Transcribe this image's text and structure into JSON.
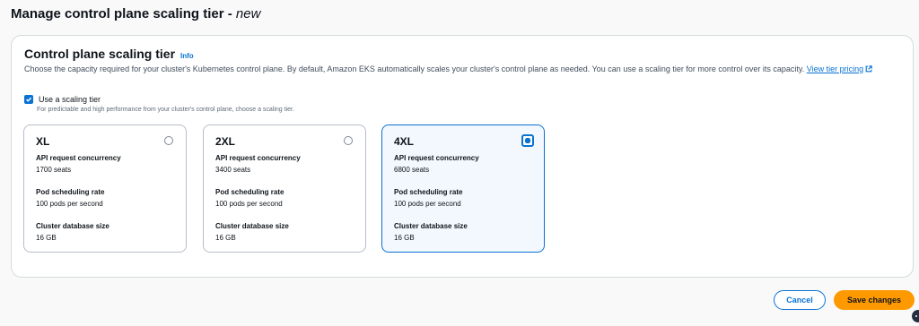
{
  "header": {
    "title": "Manage control plane scaling tier - ",
    "title_suffix": "new"
  },
  "section": {
    "title": "Control plane scaling tier",
    "info_label": "Info",
    "description": "Choose the capacity required for your cluster's Kubernetes control plane. By default, Amazon EKS automatically scales your cluster's control plane as needed. You can use a scaling tier for more control over its capacity.",
    "link_label": "View tier pricing"
  },
  "scaling_checkbox": {
    "label": "Use a scaling tier",
    "checked": true,
    "description": "For predictable and high performance from your cluster's control plane, choose a scaling tier."
  },
  "tiers": [
    {
      "name": "XL",
      "selected": false,
      "api_label": "API request concurrency",
      "api_value": "1700 seats",
      "pod_label": "Pod scheduling rate",
      "pod_value": "100 pods per second",
      "db_label": "Cluster database size",
      "db_value": "16 GB"
    },
    {
      "name": "2XL",
      "selected": false,
      "api_label": "API request concurrency",
      "api_value": "3400 seats",
      "pod_label": "Pod scheduling rate",
      "pod_value": "100 pods per second",
      "db_label": "Cluster database size",
      "db_value": "16 GB"
    },
    {
      "name": "4XL",
      "selected": true,
      "api_label": "API request concurrency",
      "api_value": "6800 seats",
      "pod_label": "Pod scheduling rate",
      "pod_value": "100 pods per second",
      "db_label": "Cluster database size",
      "db_value": "16 GB"
    }
  ],
  "actions": {
    "cancel_label": "Cancel",
    "save_label": "Save changes"
  },
  "icons": {
    "external": "external-link-icon",
    "check": "check-icon",
    "widget": "help-widget-icon"
  },
  "colors": {
    "accent": "#0972d3",
    "primary_button": "#ff9900",
    "selected_tile_bg": "#f2f8fd"
  }
}
